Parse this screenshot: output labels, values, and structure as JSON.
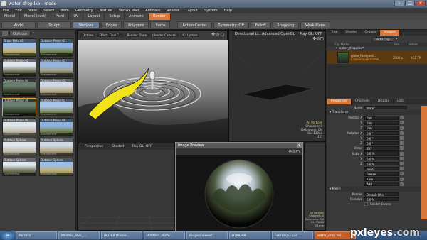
{
  "window": {
    "title": "water_drop.lxo - modo"
  },
  "menu": [
    "File",
    "Edit",
    "View",
    "Select",
    "Item",
    "Geometry",
    "Texture",
    "Vertex Map",
    "Animate",
    "Render",
    "Layout",
    "System",
    "Help"
  ],
  "layout_tabs": [
    {
      "label": "Model",
      "active": false
    },
    {
      "label": "Model (cust)",
      "active": false
    },
    {
      "label": "Paint",
      "active": false
    },
    {
      "label": "UV",
      "active": false
    },
    {
      "label": "Layout",
      "active": false
    },
    {
      "label": "Setup",
      "active": false
    },
    {
      "label": "Animate",
      "active": false
    },
    {
      "label": "Render",
      "active": true
    }
  ],
  "toolbar": {
    "model": "Model",
    "sculpt": "Sculpt",
    "outdoor": "Outdoor",
    "vertices": "Vertices",
    "edges": "Edges",
    "polygons": "Polygons",
    "items": "Items",
    "action_center": "Action Center",
    "symmetry": "Symmetry: Off",
    "falloff": "Falloff",
    "snapping": "Snapping",
    "work_plane": "Work Plane"
  },
  "presets": {
    "dropdown": "Outdoor",
    "items": [
      {
        "name": "Grass Field 01",
        "tag": "Environment",
        "style": "t1"
      },
      {
        "name": "Outdoor Probe 01",
        "tag": "Environment",
        "style": "t2"
      },
      {
        "name": "Outdoor Probe 02",
        "tag": "Environment",
        "style": "t3"
      },
      {
        "name": "Outdoor Probe 03",
        "tag": "Environment",
        "style": "t4"
      },
      {
        "name": "Outdoor Probe 04",
        "tag": "Environment",
        "style": "t5"
      },
      {
        "name": "Outdoor Probe 05",
        "tag": "Environment",
        "style": "t6"
      },
      {
        "name": "Outdoor Probe 06",
        "tag": "Environment",
        "style": "t5",
        "selected": true
      },
      {
        "name": "Outdoor Probe 07",
        "tag": "Environment",
        "style": "t7"
      },
      {
        "name": "Outdoor Probe 08",
        "tag": "Environment",
        "style": "t8"
      },
      {
        "name": "Outdoor Probe 09",
        "tag": "Environment",
        "style": "t2"
      },
      {
        "name": "Outdoor Sphere",
        "tag": "Environment",
        "style": "t8"
      },
      {
        "name": "Outdoor Sphere",
        "tag": "Environment",
        "style": "t6"
      },
      {
        "name": "Outdoor Sphere",
        "tag": "Environment",
        "style": "t3"
      },
      {
        "name": "Outdoor Sphere",
        "tag": "Environment",
        "style": "t1"
      }
    ]
  },
  "viewport_main": {
    "options": "Options",
    "effect": "Effect: Final C...",
    "render": "Render: Done",
    "camera": "(Render Camera)",
    "ic_update": "IC: Update"
  },
  "viewport_right": {
    "light_label": "Directional Li...",
    "gl_label": "Advanced OpenGL",
    "ray_label": "Ray GL: OFF",
    "hud": [
      "All Vertices",
      "Channels: 0",
      "Deformers: ON",
      "GL: 11040",
      "15\""
    ]
  },
  "viewport_bl": {
    "perspective": "Perspective",
    "shaded": "Shaded",
    "ray": "Ray GL: OFF"
  },
  "viewport_br": {
    "hud": [
      "All Vertices",
      "Channels: 0",
      "Deformers: ON",
      "GL: 11040",
      "20 mm"
    ]
  },
  "image_preview": {
    "title": "Image Preview",
    "close": "x"
  },
  "clips": {
    "tabs": [
      "Tree",
      "Shader",
      "Groups",
      "Images"
    ],
    "active_tab": "Images",
    "add_clip": "Add Clip",
    "columns": [
      "Clip Name",
      "Size",
      "Format"
    ],
    "file_row": "water_drop.lxo*",
    "clip_name": "globe_frontyard...",
    "clip_path": "C:\\Users\\username\\...",
    "clip_size": "2000 x...",
    "clip_format": "RGB FP"
  },
  "properties": {
    "tabs": [
      "Properties",
      "Channels",
      "Display",
      "Lists"
    ],
    "active_tab": "Properties",
    "name_label": "Name",
    "name_value": "Water",
    "transform_section": "Transform",
    "rows": [
      {
        "label": "Position X",
        "value": "0 m"
      },
      {
        "label": "Y",
        "value": "0 m"
      },
      {
        "label": "Z",
        "value": "0 m"
      },
      {
        "label": "Rotation X",
        "value": "0.0 °"
      },
      {
        "label": "Y",
        "value": "0.0 °"
      },
      {
        "label": "Z",
        "value": "0.0 °"
      },
      {
        "label": "Order",
        "value": "ZXY"
      },
      {
        "label": "Scale X",
        "value": "6.0 %"
      },
      {
        "label": "Y",
        "value": "6.0 %"
      },
      {
        "label": "Z",
        "value": "6.0 %"
      },
      {
        "label": "",
        "value": "Reset"
      },
      {
        "label": "",
        "value": "Freeze"
      },
      {
        "label": "",
        "value": "Zero"
      },
      {
        "label": "",
        "value": "Add"
      }
    ],
    "mesh_section": "Mesh",
    "render_label": "Render",
    "render_value": "Default (Yes)",
    "dissolve_label": "Dissolve",
    "dissolve_value": "0.0 %",
    "curves_label": "Render Curves"
  },
  "taskbar": [
    {
      "label": "Microso...",
      "active": false
    },
    {
      "label": "MoxMix_Pool_...",
      "active": false
    },
    {
      "label": "BCDEB theme...",
      "active": false
    },
    {
      "label": "Untitled - Note...",
      "active": false
    },
    {
      "label": "Binge (newest...",
      "active": false
    },
    {
      "label": "HTML-69",
      "active": false
    },
    {
      "label": "February - Loc...",
      "active": false
    },
    {
      "label": "water_drop.lxo...",
      "active": true
    }
  ],
  "watermark": {
    "main": "pxleyes",
    "suffix": ".com"
  }
}
